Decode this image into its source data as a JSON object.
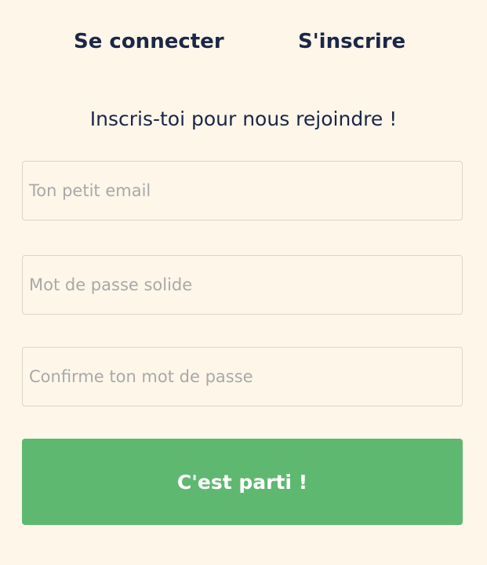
{
  "tabs": {
    "login_label": "Se connecter",
    "signup_label": "S'inscrire"
  },
  "form": {
    "subtitle": "Inscris-toi pour nous rejoindre !",
    "email_placeholder": "Ton petit email",
    "password_placeholder": "Mot de passe solide",
    "confirm_placeholder": "Confirme ton mot de passe",
    "submit_label": "C'est parti !"
  },
  "colors": {
    "background": "#fdf6e9",
    "text": "#1c2747",
    "accent": "#5fb870"
  }
}
